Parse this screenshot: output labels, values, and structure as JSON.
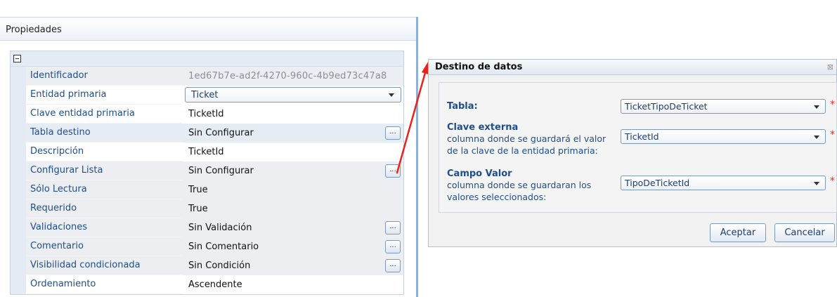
{
  "properties_panel": {
    "title": "Propiedades",
    "rows": [
      {
        "name": "Identificador",
        "value": "1ed67b7e-ad2f-4270-960c-4b9ed73c47a8"
      },
      {
        "name": "Entidad primaria",
        "value": "Ticket"
      },
      {
        "name": "Clave entidad primaria",
        "value": "TicketId"
      },
      {
        "name": "Tabla destino",
        "value": "Sin Configurar",
        "button": "..."
      },
      {
        "name": "Descripción",
        "value": "TicketId"
      },
      {
        "name": "Configurar Lista",
        "value": "Sin Configurar",
        "button": "..."
      },
      {
        "name": "Sólo Lectura",
        "value": "True"
      },
      {
        "name": "Requerido",
        "value": "True"
      },
      {
        "name": "Validaciones",
        "value": "Sin Validación",
        "button": "..."
      },
      {
        "name": "Comentario",
        "value": "Sin Comentario",
        "button": "..."
      },
      {
        "name": "Visibilidad condicionada",
        "value": "Sin Condición",
        "button": "..."
      },
      {
        "name": "Ordenamiento",
        "value": "Ascendente"
      }
    ]
  },
  "dialog": {
    "title": "Destino de datos",
    "close": "⊠",
    "fields": [
      {
        "label": "Tabla:",
        "sub": "",
        "value": "TicketTipoDeTicket"
      },
      {
        "label": "Clave externa",
        "sub": "columna donde se guardará el valor de la clave de la entidad primaria:",
        "value": "TicketId"
      },
      {
        "label": "Campo Valor",
        "sub": "columna donde se guardaran los valores seleccionados:",
        "value": "TipoDeTicketId"
      }
    ],
    "required_mark": "*",
    "accept_label": "Aceptar",
    "cancel_label": "Cancelar"
  },
  "colors": {
    "accent_blue": "#1f4e8a",
    "pointer_arrow": "#e8231c"
  }
}
